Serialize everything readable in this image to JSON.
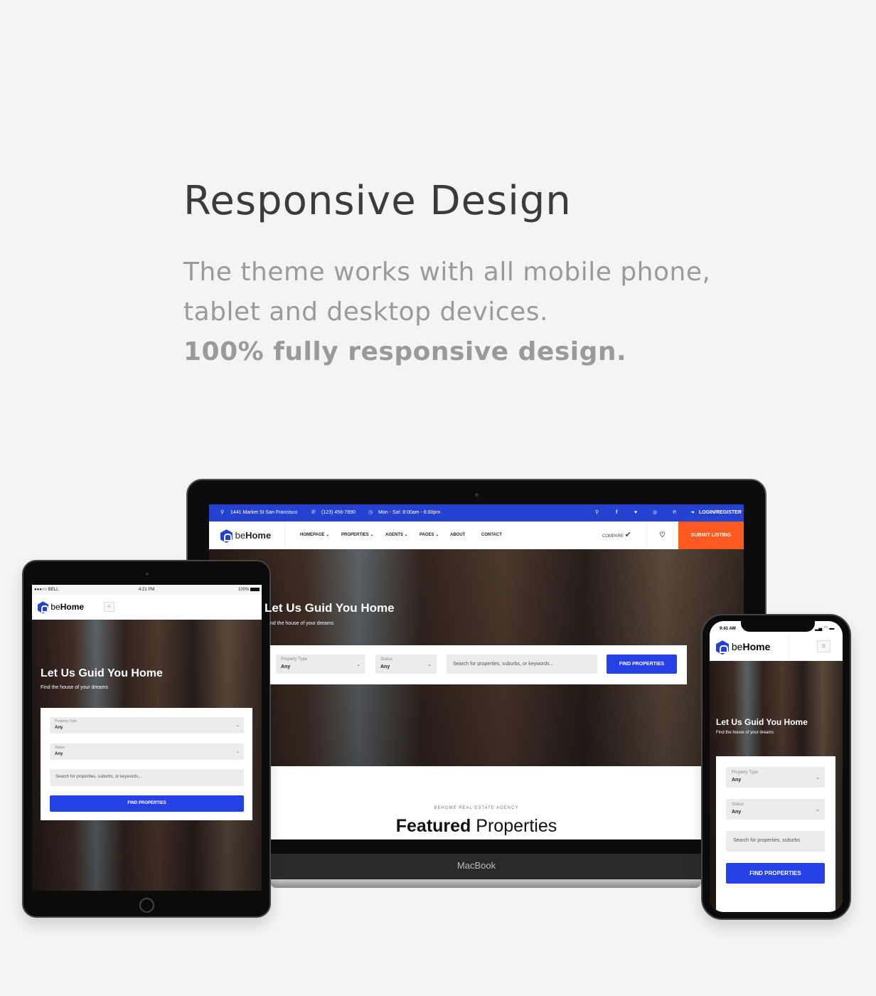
{
  "heading": "Responsive Design",
  "description": {
    "line1": "The theme works with all mobile phone,",
    "line2": "tablet and desktop devices.",
    "line3": "100% fully responsive design."
  },
  "colors": {
    "brand": "#2541cf",
    "accent": "#ff5a1f",
    "button": "#2541e6"
  },
  "site": {
    "logo": {
      "prefix": "be",
      "suffix": "Home"
    },
    "topbar": {
      "address": "1441 Market St San Francisco",
      "phone": "(123) 456-7890",
      "hours": "Mon - Sat: 8:00am - 6:00pm",
      "login": "LOGIN/REGISTER",
      "social_icons": [
        "search-icon",
        "facebook-icon",
        "twitter-icon",
        "instagram-icon",
        "pinterest-icon"
      ]
    },
    "nav": [
      {
        "label": "HOMEPAGE",
        "dropdown": true
      },
      {
        "label": "PROPERTIES",
        "dropdown": true
      },
      {
        "label": "AGENTS",
        "dropdown": true
      },
      {
        "label": "PAGES",
        "dropdown": true
      },
      {
        "label": "ABOUT",
        "dropdown": false
      },
      {
        "label": "CONTACT",
        "dropdown": false
      }
    ],
    "compare": "COMPARE",
    "submit": "SUBMIT LISTING",
    "hero": {
      "title": "Let Us Guid You Home",
      "subtitle": "Find the house of your dreams",
      "subtitle_cut": "nd the house of your dreams"
    },
    "search": {
      "type_label": "Property Type",
      "type_value": "Any",
      "status_label": "Status",
      "status_value": "Any",
      "placeholder": "Search for properties, suburbs, or keywords...",
      "phone_placeholder": "Search for properties, suburbs",
      "button": "FIND PROPERTIES"
    },
    "section": {
      "eyebrow": "BEHOME REAL ESTATE AGENCY",
      "title_bold": "Featured",
      "title_rest": " Properties"
    }
  },
  "devices": {
    "laptop": {
      "label": "MacBook"
    },
    "tablet": {
      "carrier": "●●●○○ BELL",
      "time": "4:21 PM",
      "battery": "100%"
    },
    "phone": {
      "time": "9:41 AM"
    }
  }
}
